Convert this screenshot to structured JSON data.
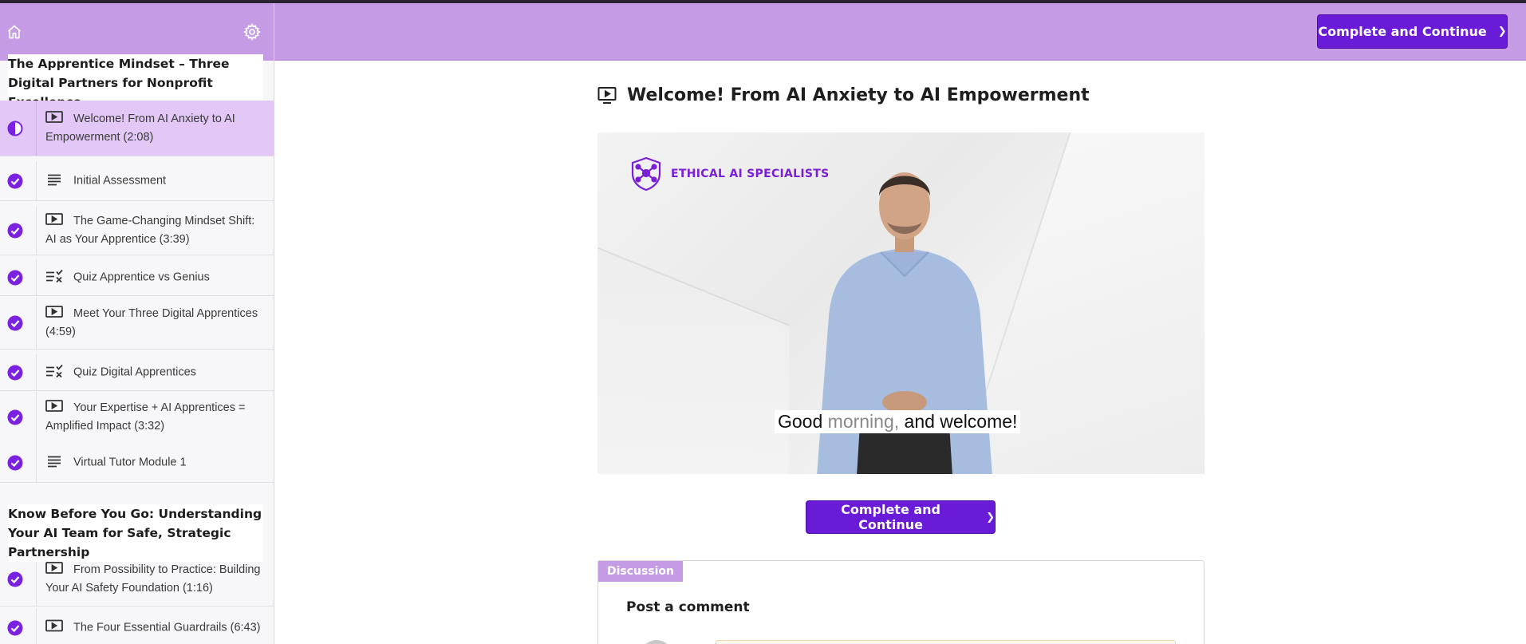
{
  "sidebar": {
    "sections": [
      {
        "title": "The Apprentice Mindset – Three Digital Partners for Nonprofit Excellence"
      },
      {
        "title": "Know Before You Go: Understanding Your AI Team for Safe, Strategic Partnership"
      }
    ],
    "lessons": [
      {
        "label": "Welcome! From AI Anxiety to AI Empowerment (2:08)",
        "type": "video-icon",
        "status": "in-progress"
      },
      {
        "label": "Initial Assessment",
        "type": "text-icon",
        "status": "complete"
      },
      {
        "label": "The Game-Changing Mindset Shift: AI as Your Apprentice (3:39)",
        "type": "video-icon",
        "status": "complete"
      },
      {
        "label": "Quiz Apprentice vs Genius",
        "type": "quiz-icon",
        "status": "complete"
      },
      {
        "label": "Meet Your Three Digital Apprentices (4:59)",
        "type": "video-icon",
        "status": "complete"
      },
      {
        "label": "Quiz Digital Apprentices",
        "type": "quiz-icon",
        "status": "complete"
      },
      {
        "label": "Your Expertise + AI Apprentices = Amplified Impact (3:32)",
        "type": "video-icon",
        "status": "complete"
      },
      {
        "label": "Virtual Tutor Module 1",
        "type": "text-icon",
        "status": "complete"
      },
      {
        "label": "From Possibility to Practice: Building Your AI Safety Foundation (1:16)",
        "type": "video-icon",
        "status": "complete"
      },
      {
        "label": "The Four Essential Guardrails (6:43)",
        "type": "video-icon",
        "status": "complete"
      }
    ]
  },
  "header": {
    "complete_label": "Complete and Continue"
  },
  "main": {
    "lesson_title": "Welcome! From AI Anxiety to AI Empowerment",
    "video": {
      "brand": "ETHICAL AI SPECIALISTS",
      "caption_a": "Good ",
      "caption_b": "morning,",
      "caption_c": " and welcome!"
    },
    "complete_label": "Complete and Continue",
    "discussion": {
      "tab": "Discussion",
      "post_title": "Post a comment"
    }
  },
  "colors": {
    "accent": "#6a1bd8",
    "header_bg": "#c49be4",
    "check": "#7a22e0"
  }
}
